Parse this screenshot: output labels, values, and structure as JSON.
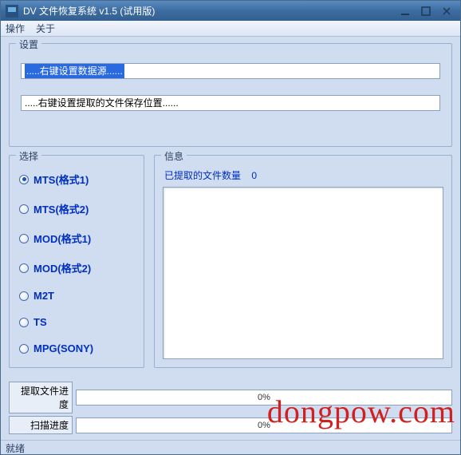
{
  "title": "DV 文件恢复系统 v1.5 (试用版)",
  "menu": {
    "operate": "操作",
    "about": "关于"
  },
  "settings": {
    "group_title": "设置",
    "source_text": ".....右键设置数据源......",
    "target_text": ".....右键设置提取的文件保存位置......"
  },
  "select": {
    "group_title": "选择",
    "options": [
      "MTS(格式1)",
      "MTS(格式2)",
      "MOD(格式1)",
      "MOD(格式2)",
      "M2T",
      "TS",
      "MPG(SONY)"
    ],
    "selected_index": 0
  },
  "info": {
    "group_title": "信息",
    "extracted_label": "已提取的文件数量",
    "extracted_count": "0"
  },
  "progress": {
    "extract_label": "提取文件进度",
    "extract_pct": "0%",
    "scan_label": "扫描进度",
    "scan_pct": "0%"
  },
  "status": "就绪",
  "watermark": "dongpow.com"
}
